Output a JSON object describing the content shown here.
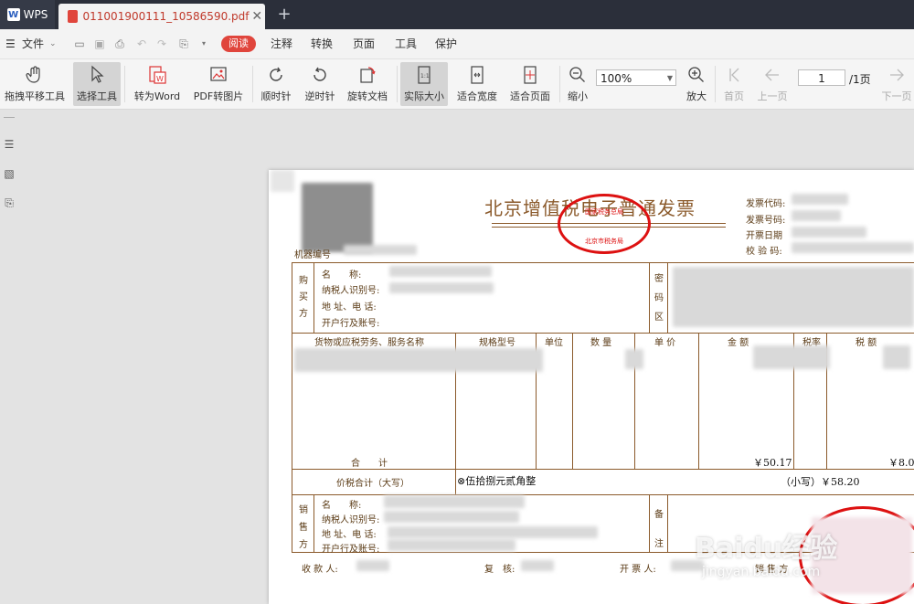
{
  "titlebar": {
    "app_label": "WPS",
    "doc_tab": "011001900111_10586590.pdf",
    "close": "✕",
    "new_tab": "+"
  },
  "menubar": {
    "file": "文件",
    "read": "阅读",
    "items": [
      "注释",
      "转换",
      "页面",
      "工具",
      "保护"
    ]
  },
  "toolbar": {
    "hand": "拖拽平移工具",
    "select": "选择工具",
    "to_word": "转为Word",
    "pdf_to_img": "PDF转图片",
    "rotate_cw": "顺时针",
    "rotate_ccw": "逆时针",
    "rotate_doc": "旋转文档",
    "actual_size": "实际大小",
    "fit_width": "适合宽度",
    "fit_page": "适合页面",
    "zoom_out": "缩小",
    "zoom_value": "100%",
    "zoom_in": "放大",
    "first_page": "首页",
    "prev_page": "上一页",
    "page_current": "1",
    "page_total": "/1页",
    "next_page": "下一页"
  },
  "invoice": {
    "title": "北京增值税电子普通发票",
    "stamp_top": "国家税务总局",
    "stamp_bottom": "北京市税务局",
    "code_label": "发票代码:",
    "number_label": "发票号码:",
    "date_label": "开票日期",
    "check_label": "校 验 码:",
    "machine_label": "机器编号",
    "buyer_side": [
      "购",
      "买",
      "方"
    ],
    "buyer_name_label": "名　　称:",
    "buyer_tax_label": "纳税人识别号:",
    "buyer_addr_label": "地 址、电 话:",
    "buyer_bank_label": "开户行及账号:",
    "pwd_side": [
      "密",
      "码",
      "区"
    ],
    "col_goods": "货物或应税劳务、服务名称",
    "col_spec": "规格型号",
    "col_unit": "单位",
    "col_qty": "数 量",
    "col_price": "单 价",
    "col_amount": "金 额",
    "col_rate": "税率",
    "col_tax": "税 额",
    "total_label": "合　　计",
    "total_amount": "￥50.17",
    "total_tax": "￥8.0",
    "sum_label": "价税合计（大写）",
    "sum_words": "⊗伍拾捌元贰角整",
    "sum_small": "（小写）￥58.20",
    "seller_side": [
      "销",
      "售",
      "方"
    ],
    "seller_name_label": "名　　称:",
    "seller_tax_label": "纳税人识别号:",
    "seller_addr_label": "地 址、电 话:",
    "seller_bank_label": "开户行及账号:",
    "remark_side": [
      "备",
      "注"
    ],
    "payee_label": "收 款 人:",
    "reviewer_label": "复　核:",
    "drawer_label": "开 票 人:",
    "seller_sig_label": "销 售 方"
  },
  "watermark": {
    "brand": "Baidu经验",
    "url": "jingyan.baidu.com"
  }
}
